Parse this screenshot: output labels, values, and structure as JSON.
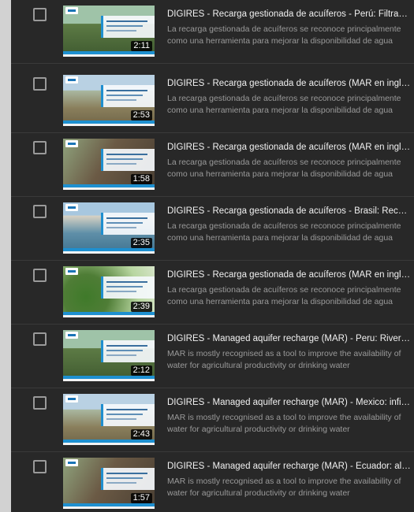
{
  "videos": [
    {
      "title": "DIGIRES - Recarga gestionada de acuíferos - Perú: Filtración en zanjas",
      "description": "La recarga gestionada de acuíferos se reconoce principalmente como una herramienta para mejorar la disponibilidad de agua",
      "duration": "2:11",
      "thumb_sky": "#9fc3a8",
      "thumb_ground": "#5d7b45"
    },
    {
      "title": "DIGIRES - Recarga gestionada de acuíferos (MAR en inglés) - México",
      "description": "La recarga gestionada de acuíferos se reconoce principalmente como una herramienta para mejorar la disponibilidad de agua",
      "duration": "2:53",
      "thumb_sky": "#b9d1e3",
      "thumb_ground": "#8a7f5c"
    },
    {
      "title": "DIGIRES - Recarga gestionada de acuíferos (MAR en inglés) - Ecuador",
      "description": "La recarga gestionada de acuíferos se reconoce principalmente como una herramienta para mejorar la disponibilidad de agua",
      "duration": "1:58",
      "thumb_sky": "#8fa37d",
      "thumb_ground": "#6b5a45"
    },
    {
      "title": "DIGIRES - Recarga gestionada de acuíferos - Brasil: Recarga urbana",
      "description": "La recarga gestionada de acuíferos se reconoce principalmente como una herramienta para mejorar la disponibilidad de agua",
      "duration": "2:35",
      "thumb_sky": "#a7c7df",
      "thumb_ground": "#5f8fa8"
    },
    {
      "title": "DIGIRES - Recarga gestionada de acuíferos (MAR en inglés) - Colombia",
      "description": "La recarga gestionada de acuíferos se reconoce principalmente como una herramienta para mejorar la disponibilidad de agua",
      "duration": "2:39",
      "thumb_sky": "#b8d6a0",
      "thumb_ground": "#4f7d36"
    },
    {
      "title": "DIGIRES - Managed aquifer recharge (MAR) - Peru: River bank filtration",
      "description": "MAR is mostly recognised as a tool to improve the availability of water for agricultural productivity or drinking water",
      "duration": "2:12",
      "thumb_sky": "#9fc3a8",
      "thumb_ground": "#5d7b45"
    },
    {
      "title": "DIGIRES - Managed aquifer recharge (MAR) - Mexico: infiltration wells",
      "description": "MAR is mostly recognised as a tool to improve the availability of water for agricultural productivity or drinking water",
      "duration": "2:43",
      "thumb_sky": "#b9d1e3",
      "thumb_ground": "#8a7f5c"
    },
    {
      "title": "DIGIRES - Managed aquifer recharge (MAR) - Ecuador: albarradas",
      "description": "MAR is mostly recognised as a tool to improve the availability of water for agricultural productivity or drinking water",
      "duration": "1:57",
      "thumb_sky": "#8fa37d",
      "thumb_ground": "#6b5a45"
    }
  ]
}
